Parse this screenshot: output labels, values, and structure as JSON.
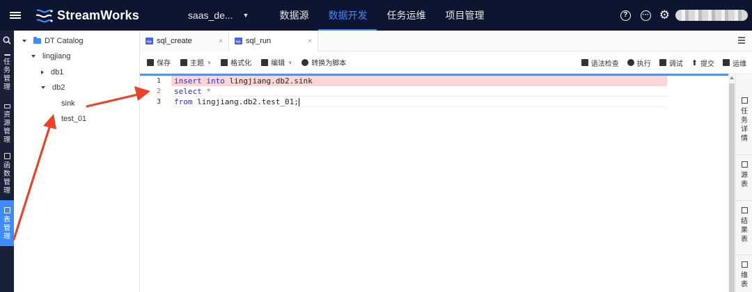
{
  "app": {
    "name": "StreamWorks",
    "workspace": "saas_de..."
  },
  "nav": [
    {
      "label": "数据源",
      "active": false
    },
    {
      "label": "数据开发",
      "active": true
    },
    {
      "label": "任务运维",
      "active": false
    },
    {
      "label": "项目管理",
      "active": false
    }
  ],
  "header_icons": [
    "help-icon",
    "chat-icon",
    "settings-icon"
  ],
  "left_rail": {
    "items": [
      {
        "label": [
          "任",
          "务",
          "管",
          "理"
        ],
        "icon": "task-icon",
        "active": false
      },
      {
        "label": [
          "资",
          "源",
          "管",
          "理"
        ],
        "icon": "resource-icon",
        "active": false
      },
      {
        "label": [
          "函",
          "数",
          "管",
          "理"
        ],
        "icon": "function-icon",
        "active": false
      },
      {
        "label": [
          "表",
          "管",
          "理"
        ],
        "icon": "table-icon",
        "active": true
      }
    ]
  },
  "tree": {
    "root": "DT Catalog",
    "database": "lingjiang",
    "schemas": [
      "db1",
      "db2"
    ],
    "tables": [
      "sink",
      "test_01"
    ]
  },
  "tabs": [
    {
      "label": "sql_create",
      "badge": "SQL",
      "active": false
    },
    {
      "label": "sql_run",
      "badge": "SQL",
      "active": true
    }
  ],
  "toolbar": {
    "left": [
      {
        "label": "保存",
        "dropdown": false
      },
      {
        "label": "主题",
        "dropdown": true
      },
      {
        "label": "格式化",
        "dropdown": false
      },
      {
        "label": "编辑",
        "dropdown": true
      },
      {
        "label": "转换为脚本",
        "dropdown": false
      }
    ],
    "right": [
      {
        "label": "语法检查"
      },
      {
        "label": "执行"
      },
      {
        "label": "调试"
      },
      {
        "label": "提交"
      },
      {
        "label": "运维"
      }
    ]
  },
  "code": {
    "line_numbers": [
      "1",
      "2",
      "3"
    ],
    "line1": {
      "kw1": "insert",
      "kw2": "into",
      "rest": "lingjiang.db2.sink"
    },
    "line2": {
      "kw": "select",
      "op": "*"
    },
    "line3": {
      "kw": "from",
      "rest": "lingjiang.db2.test_01;"
    }
  },
  "right_panel": [
    {
      "label": [
        "任",
        "务",
        "详",
        "情"
      ],
      "icon": "detail-icon"
    },
    {
      "label": [
        "源",
        "表"
      ],
      "icon": "source-table-icon"
    },
    {
      "label": [
        "结",
        "果",
        "表"
      ],
      "icon": "result-table-icon"
    },
    {
      "label": [
        "维",
        "表"
      ],
      "icon": "dim-table-icon"
    }
  ],
  "colors": {
    "topbar": "#0e1530",
    "accent": "#3d8bff",
    "annotation_arrow": "#e8442a",
    "error_highlight": "#fbd6d6"
  }
}
